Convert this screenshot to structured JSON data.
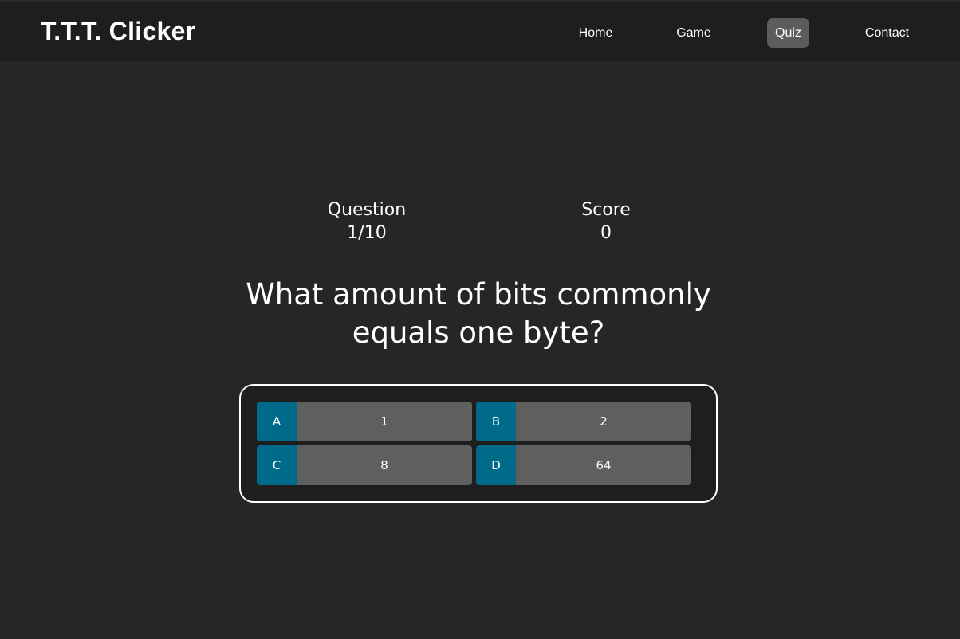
{
  "header": {
    "brand": "T.T.T. Clicker",
    "nav": {
      "home": "Home",
      "game": "Game",
      "quiz": "Quiz",
      "contact": "Contact"
    },
    "active_nav": "Quiz"
  },
  "hud": {
    "question_label": "Question",
    "question_value": "1/10",
    "score_label": "Score",
    "score_value": "0"
  },
  "quiz": {
    "question": "What amount of bits commonly equals one byte?",
    "choices": [
      {
        "prefix": "A",
        "text": "1"
      },
      {
        "prefix": "B",
        "text": "2"
      },
      {
        "prefix": "C",
        "text": "8"
      },
      {
        "prefix": "D",
        "text": "64"
      }
    ]
  },
  "colors": {
    "background": "#262626",
    "header_bg": "#1e1e1e",
    "active_nav_bg": "#5c5c5c",
    "choice_prefix_bg": "#006a8a",
    "choice_text_bg": "#5f5f5f"
  }
}
